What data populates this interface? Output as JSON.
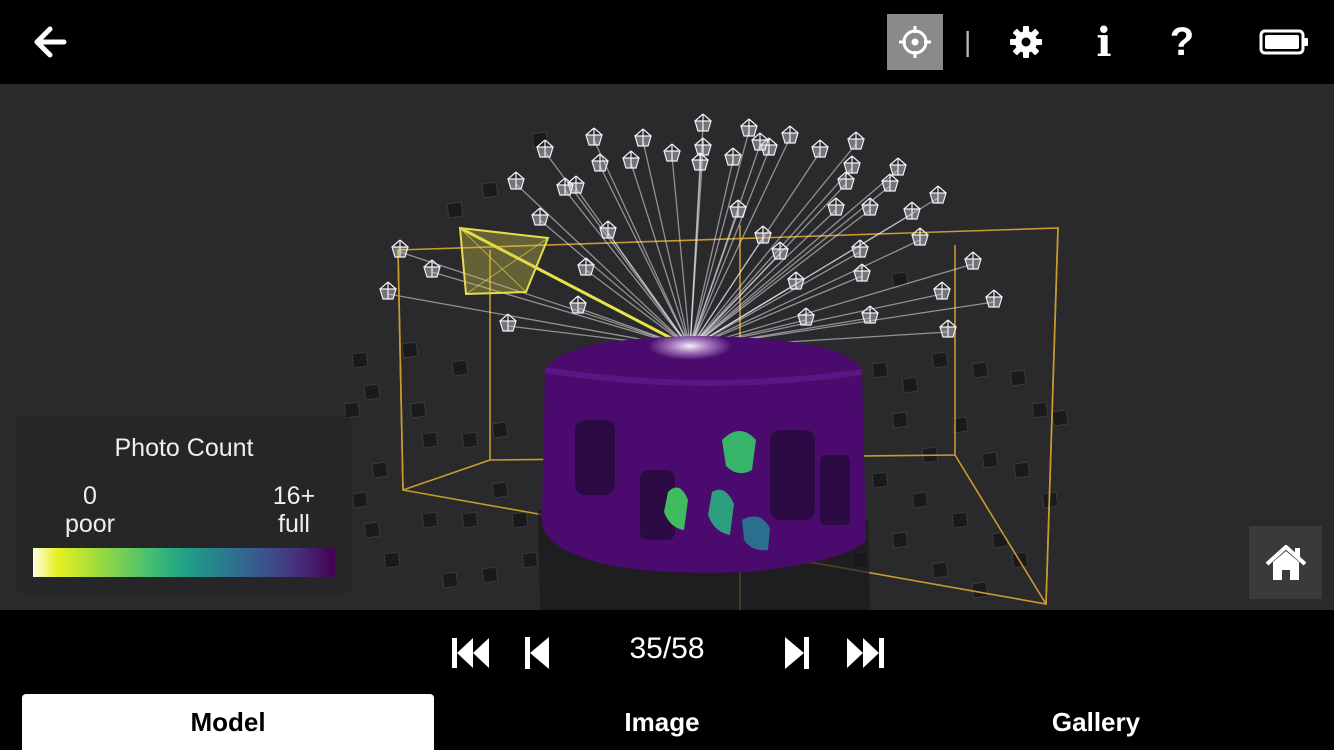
{
  "topbar": {
    "icons": [
      "back-arrow-icon",
      "crosshair-icon",
      "gear-icon",
      "info-icon",
      "help-icon",
      "battery-icon"
    ],
    "separator": "|",
    "help_glyph": "?",
    "info_glyph": "i"
  },
  "legend": {
    "title": "Photo Count",
    "min_value": "0",
    "min_label": "poor",
    "max_value": "16+",
    "max_label": "full"
  },
  "playback": {
    "counter": "35/58",
    "current": 35,
    "total": 58
  },
  "tabs": [
    {
      "label": "Model",
      "active": true
    },
    {
      "label": "Image",
      "active": false
    },
    {
      "label": "Gallery",
      "active": false
    }
  ],
  "colors": {
    "accent_bbox": "#c99a2e",
    "active_tab_bg": "#ffffff",
    "model_purple": "#4a0a6e",
    "selected_button_bg": "#8a8a8a"
  }
}
